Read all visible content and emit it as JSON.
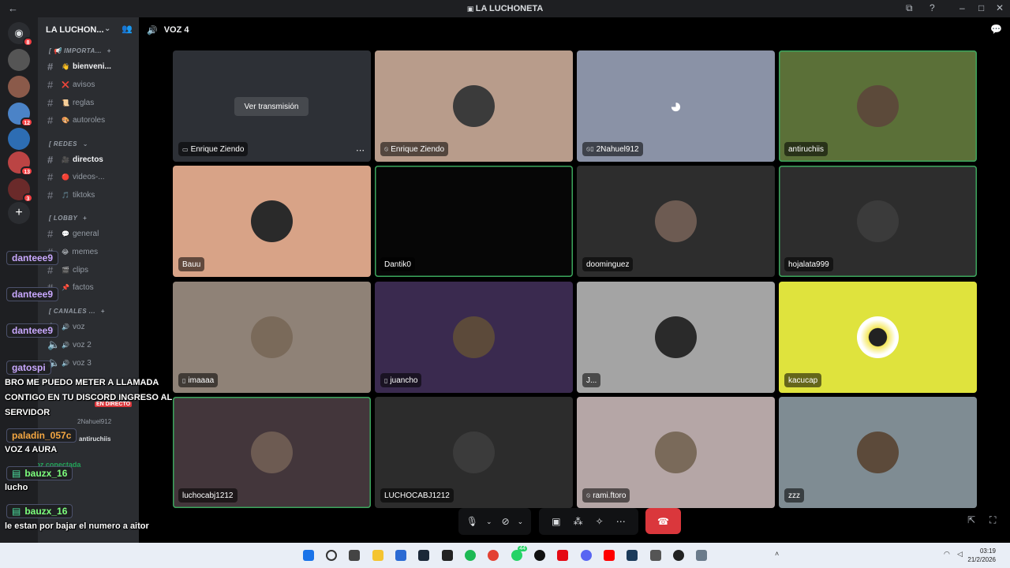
{
  "window": {
    "title": "LA LUCHONETA"
  },
  "server_rail": {
    "badges": [
      "8",
      "12",
      "13",
      "3"
    ]
  },
  "channel_sidebar": {
    "guild_name": "LA LUCHON...",
    "categories": [
      {
        "label": "[ 📢 IMPORTA..."
      },
      {
        "label": "[ REDES"
      },
      {
        "label": "[ LOBBY"
      },
      {
        "label": "[ CANALES ..."
      }
    ],
    "channels": [
      {
        "label": "bienveni...",
        "emoji": "👋",
        "unread": true
      },
      {
        "label": "avisos",
        "emoji": "❌",
        "unread": false
      },
      {
        "label": "reglas",
        "emoji": "📜",
        "unread": false
      },
      {
        "label": "autoroles",
        "emoji": "🎨",
        "unread": false
      },
      {
        "label": "directos",
        "emoji": "🎥",
        "unread": true
      },
      {
        "label": "videos-...",
        "emoji": "🔴",
        "unread": false
      },
      {
        "label": "tiktoks",
        "emoji": "🎵",
        "unread": false
      },
      {
        "label": "general",
        "emoji": "💬",
        "unread": false
      },
      {
        "label": "memes",
        "emoji": "😂",
        "unread": false
      },
      {
        "label": "clips",
        "emoji": "🎬",
        "unread": false
      },
      {
        "label": "factos",
        "emoji": "📌",
        "unread": false
      },
      {
        "label": "voz",
        "emoji": "🔊",
        "unread": false
      },
      {
        "label": "voz 2",
        "emoji": "🔊",
        "unread": false
      },
      {
        "label": "voz 3",
        "emoji": "🔊",
        "unread": false
      }
    ],
    "live_badge": "EN DIRECTO",
    "voice_members": [
      "2Nahuel912",
      "antiruchiis"
    ],
    "voice_connected": "Voz conectada"
  },
  "voice_channel": {
    "name": "VOZ 4",
    "watch_stream_label": "Ver transmisión",
    "tiles": [
      {
        "name": "Enrique Ziendo",
        "icon": "screen-share-icon",
        "bg": "#2d3036",
        "speaking": false,
        "stream": true
      },
      {
        "name": "Enrique Ziendo",
        "icon": "mic-muted-icon",
        "bg": "#b89c8b",
        "speaking": false
      },
      {
        "name": "2Nahuel912",
        "icon": "mic-muted-mobile-icon",
        "bg": "#8a92a6",
        "speaking": false,
        "discord_logo": true
      },
      {
        "name": "antiruchiis",
        "icon": "",
        "bg": "#5b7038",
        "speaking": true
      },
      {
        "name": "Bauu",
        "icon": "",
        "bg": "#d8a387",
        "speaking": false
      },
      {
        "name": "Dantik0",
        "icon": "",
        "bg": "#060606",
        "speaking": true
      },
      {
        "name": "doominguez",
        "icon": "",
        "bg": "#2d2d2d",
        "speaking": false
      },
      {
        "name": "hojalata999",
        "icon": "",
        "bg": "#2d2d2d",
        "speaking": true
      },
      {
        "name": "imaaaa",
        "icon": "mobile-icon",
        "bg": "#8f8277",
        "speaking": false
      },
      {
        "name": "juancho",
        "icon": "mobile-icon",
        "bg": "#3a2a4f",
        "speaking": false
      },
      {
        "name": "J...",
        "icon": "",
        "bg": "#a4a4a4",
        "speaking": false
      },
      {
        "name": "kacucap",
        "icon": "",
        "bg": "#dfe33d",
        "speaking": false
      },
      {
        "name": "luchocabj1212",
        "icon": "",
        "bg": "#43363b",
        "speaking": true
      },
      {
        "name": "LUCHOCABJ1212",
        "icon": "",
        "bg": "#2c2c2c",
        "speaking": false
      },
      {
        "name": "rami.ftoro",
        "icon": "mic-muted-icon",
        "bg": "#b5a6a6",
        "speaking": false
      },
      {
        "name": "zzz",
        "icon": "",
        "bg": "#7f8c93",
        "speaking": false
      }
    ]
  },
  "chat_overlay": [
    {
      "user": "danteee9",
      "color": "#c9a8ff",
      "text": ""
    },
    {
      "user": "danteee9",
      "color": "#c9a8ff",
      "text": ""
    },
    {
      "user": "danteee9",
      "color": "#c9a8ff",
      "text": ""
    },
    {
      "user": "gatospi",
      "color": "#c9a8ff",
      "text": "BRO ME PUEDO METER A LLAMADA CONTIGO EN TU DISCORD INGRESO AL SERVIDOR"
    },
    {
      "user": "paladin_057c",
      "color": "#f4a742",
      "text": "VOZ 4 AURA"
    },
    {
      "user": "bauzx_16",
      "color": "#7dff7d",
      "text": "lucho"
    },
    {
      "user": "bauzx_16",
      "color": "#7dff7d",
      "text": "le estan por bajar el numero a aitor"
    }
  ],
  "taskbar": {
    "time": "03:19",
    "date": "21/2/2026",
    "badge": "44"
  }
}
